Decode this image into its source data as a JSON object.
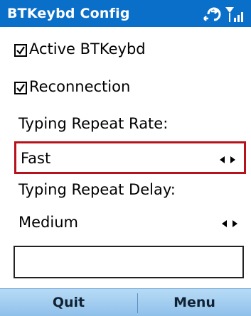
{
  "titlebar": {
    "title": "BTKeybd Config",
    "icons": [
      "bluetooth-sync-icon",
      "signal-strength-icon"
    ]
  },
  "options": {
    "active_label": "Active BTKeybd",
    "active_checked": true,
    "reconnection_label": "Reconnection",
    "reconnection_checked": true
  },
  "repeat_rate": {
    "label": "Typing Repeat Rate:",
    "value": "Fast"
  },
  "repeat_delay": {
    "label": "Typing Repeat Delay:",
    "value": "Medium"
  },
  "softkeys": {
    "left": "Quit",
    "right": "Menu"
  },
  "colors": {
    "titlebar_bg": "#0a6fc8",
    "selection_border": "#b5121b",
    "softkey_bg": "#a6cff1"
  }
}
